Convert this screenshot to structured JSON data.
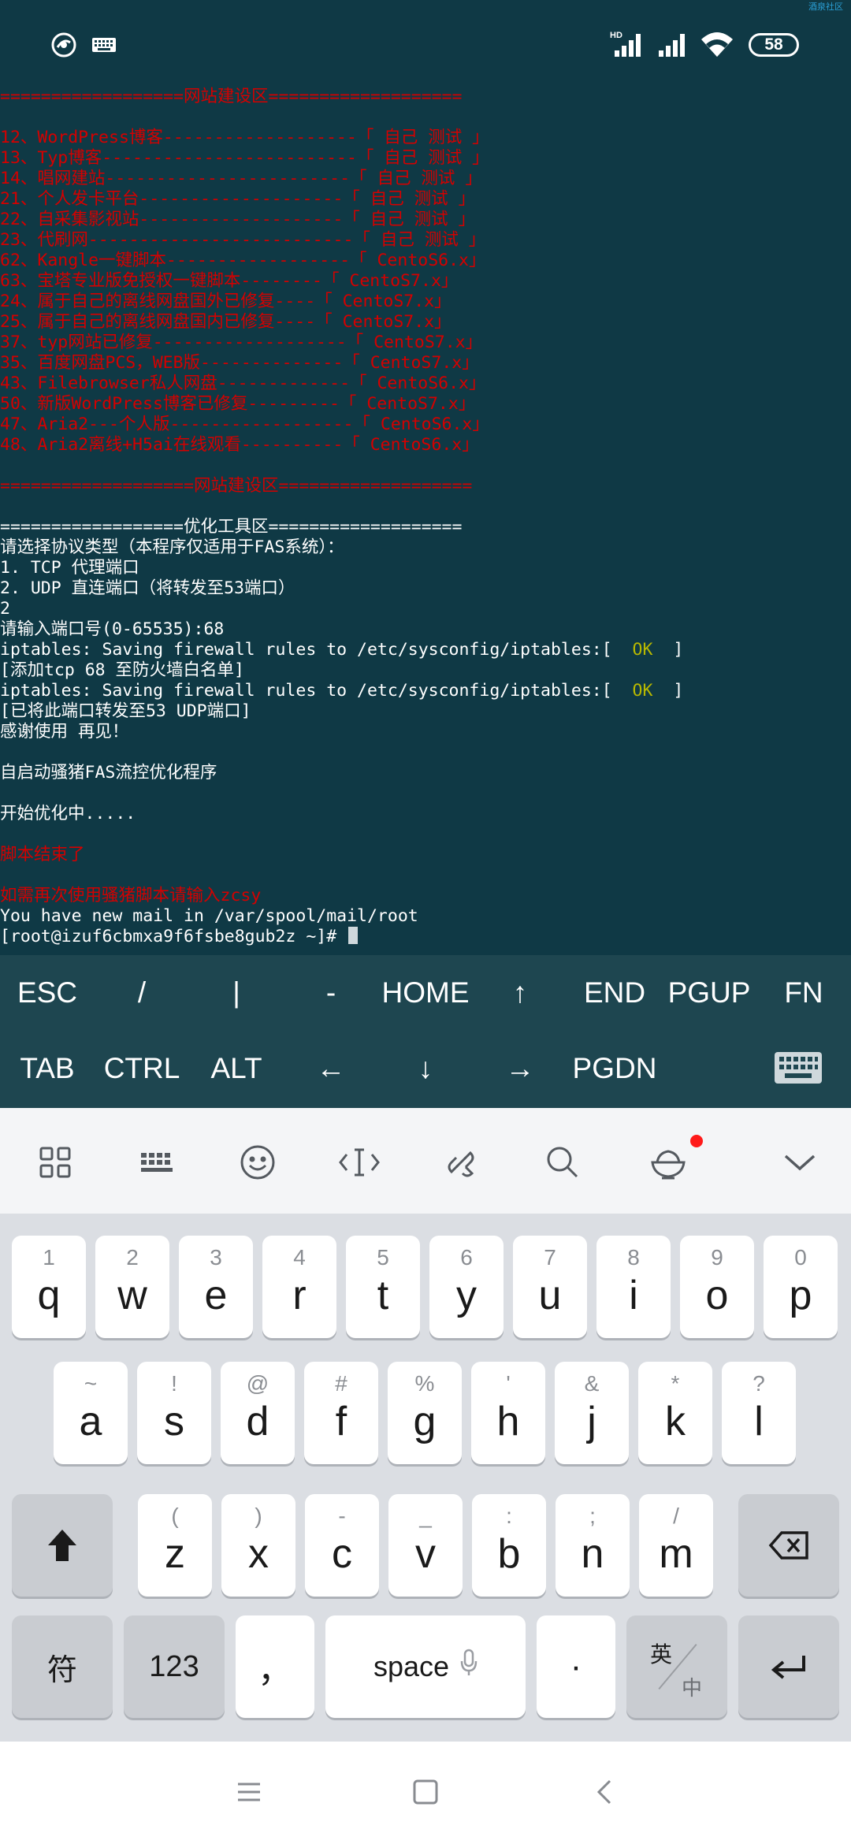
{
  "status_bar": {
    "icons": [
      "bug-icon",
      "keyboard-icon",
      "hd-signal-icon",
      "signal-icon",
      "wifi-icon"
    ],
    "battery": "58",
    "watermark": "酒泉社区"
  },
  "terminal": {
    "lines": [
      {
        "text": "==================网站建设区===================",
        "color": "red"
      },
      {
        "text": "",
        "color": "white"
      },
      {
        "text": "12、WordPress博客-------------------「 自己 测试 」",
        "color": "red"
      },
      {
        "text": "13、Typ博客-------------------------「 自己 测试 」",
        "color": "red"
      },
      {
        "text": "14、唱网建站------------------------「 自己 测试 」",
        "color": "red"
      },
      {
        "text": "21、个人发卡平台--------------------「 自己 测试 」",
        "color": "red"
      },
      {
        "text": "22、自采集影视站--------------------「 自己 测试 」",
        "color": "red"
      },
      {
        "text": "23、代刷网--------------------------「 自己 测试 」",
        "color": "red"
      },
      {
        "text": "62、Kangle一键脚本------------------「 CentoS6.x」",
        "color": "red"
      },
      {
        "text": "63、宝塔专业版免授权一键脚本--------「 CentoS7.x」",
        "color": "red"
      },
      {
        "text": "24、属于自己的离线网盘国外已修复----「 CentoS7.x」",
        "color": "red"
      },
      {
        "text": "25、属于自己的离线网盘国内已修复----「 CentoS7.x」",
        "color": "red"
      },
      {
        "text": "37、typ网站已修复-------------------「 CentoS7.x」",
        "color": "red"
      },
      {
        "text": "35、百度网盘PCS，WEB版--------------「 CentoS7.x」",
        "color": "red"
      },
      {
        "text": "43、Filebrowser私人网盘-------------「 CentoS6.x」",
        "color": "red"
      },
      {
        "text": "50、新版WordPress博客已修复---------「 CentoS7.x」",
        "color": "red"
      },
      {
        "text": "47、Aria2---个人版------------------「 CentoS6.x」",
        "color": "red"
      },
      {
        "text": "48、Aria2离线+H5ai在线观看----------「 CentoS6.x」",
        "color": "red"
      },
      {
        "text": "",
        "color": "white"
      },
      {
        "text": "===================网站建设区===================",
        "color": "red"
      },
      {
        "text": "",
        "color": "white"
      },
      {
        "text": "==================优化工具区===================",
        "color": "white"
      },
      {
        "text": "请选择协议类型（本程序仅适用于FAS系统）：",
        "color": "white"
      },
      {
        "text": "1. TCP 代理端口",
        "color": "white"
      },
      {
        "text": "2. UDP 直连端口（将转发至53端口）",
        "color": "white"
      },
      {
        "text": "2",
        "color": "white"
      },
      {
        "text": "请输入端口号(0-65535):68",
        "color": "white"
      },
      {
        "text": "iptables: Saving firewall rules to /etc/sysconfig/iptables:[  ",
        "ok": "OK",
        "tail": "  ]",
        "color": "white"
      },
      {
        "text": "[添加tcp 68 至防火墙白名单]",
        "color": "white"
      },
      {
        "text": "iptables: Saving firewall rules to /etc/sysconfig/iptables:[  ",
        "ok": "OK",
        "tail": "  ]",
        "color": "white"
      },
      {
        "text": "[已将此端口转发至53 UDP端口]",
        "color": "white"
      },
      {
        "text": "感谢使用 再见！",
        "color": "white"
      },
      {
        "text": "",
        "color": "white"
      },
      {
        "text": "自启动骚猪FAS流控优化程序",
        "color": "white"
      },
      {
        "text": "",
        "color": "white"
      },
      {
        "text": "开始优化中.....",
        "color": "white"
      },
      {
        "text": "",
        "color": "white"
      },
      {
        "text": "脚本结束了",
        "color": "red"
      },
      {
        "text": "",
        "color": "white"
      },
      {
        "text": "如需再次使用骚猪脚本请输入zcsy",
        "color": "red"
      },
      {
        "text": "You have new mail in /var/spool/mail/root",
        "color": "white"
      },
      {
        "text": "[root@izuf6cbmxa9f6fsbe8gub2z ~]# ",
        "color": "white",
        "cursor": true
      }
    ]
  },
  "extra_keys": {
    "row1": [
      "ESC",
      "/",
      "|",
      "-",
      "HOME",
      "↑",
      "END",
      "PGUP",
      "FN"
    ],
    "row2": [
      "TAB",
      "CTRL",
      "ALT",
      "←",
      "↓",
      "→",
      "PGDN"
    ],
    "row2_icon": "keyboard-toggle-icon"
  },
  "ime_toolbar": {
    "icons": [
      "grid-menu-icon",
      "keyboard-layout-icon",
      "emoji-icon",
      "cursor-move-icon",
      "clipboard-link-icon",
      "search-icon",
      "rice-bowl-icon",
      "collapse-chevron-icon"
    ],
    "badge_color": "#ff1a1a"
  },
  "keyboard": {
    "row1": [
      {
        "hint": "1",
        "key": "q"
      },
      {
        "hint": "2",
        "key": "w"
      },
      {
        "hint": "3",
        "key": "e"
      },
      {
        "hint": "4",
        "key": "r"
      },
      {
        "hint": "5",
        "key": "t"
      },
      {
        "hint": "6",
        "key": "y"
      },
      {
        "hint": "7",
        "key": "u"
      },
      {
        "hint": "8",
        "key": "i"
      },
      {
        "hint": "9",
        "key": "o"
      },
      {
        "hint": "0",
        "key": "p"
      }
    ],
    "row2": [
      {
        "hint": "~",
        "key": "a"
      },
      {
        "hint": "!",
        "key": "s"
      },
      {
        "hint": "@",
        "key": "d"
      },
      {
        "hint": "#",
        "key": "f"
      },
      {
        "hint": "%",
        "key": "g"
      },
      {
        "hint": "'",
        "key": "h"
      },
      {
        "hint": "&",
        "key": "j"
      },
      {
        "hint": "*",
        "key": "k"
      },
      {
        "hint": "?",
        "key": "l"
      }
    ],
    "row3": [
      {
        "hint": "(",
        "key": "z"
      },
      {
        "hint": ")",
        "key": "x"
      },
      {
        "hint": "-",
        "key": "c"
      },
      {
        "hint": "_",
        "key": "v"
      },
      {
        "hint": ":",
        "key": "b"
      },
      {
        "hint": ";",
        "key": "n"
      },
      {
        "hint": "/",
        "key": "m"
      }
    ],
    "symbols_label": "符",
    "numbers_label": "123",
    "comma_label": "，",
    "space_label": "space",
    "period_label": "·",
    "lang_top": "英",
    "lang_bottom": "中"
  },
  "colors": {
    "terminal_bg": "#0f3945",
    "red_text": "#d40000",
    "ok_text": "#b8b800",
    "extra_keys_bg": "#1e4650"
  }
}
